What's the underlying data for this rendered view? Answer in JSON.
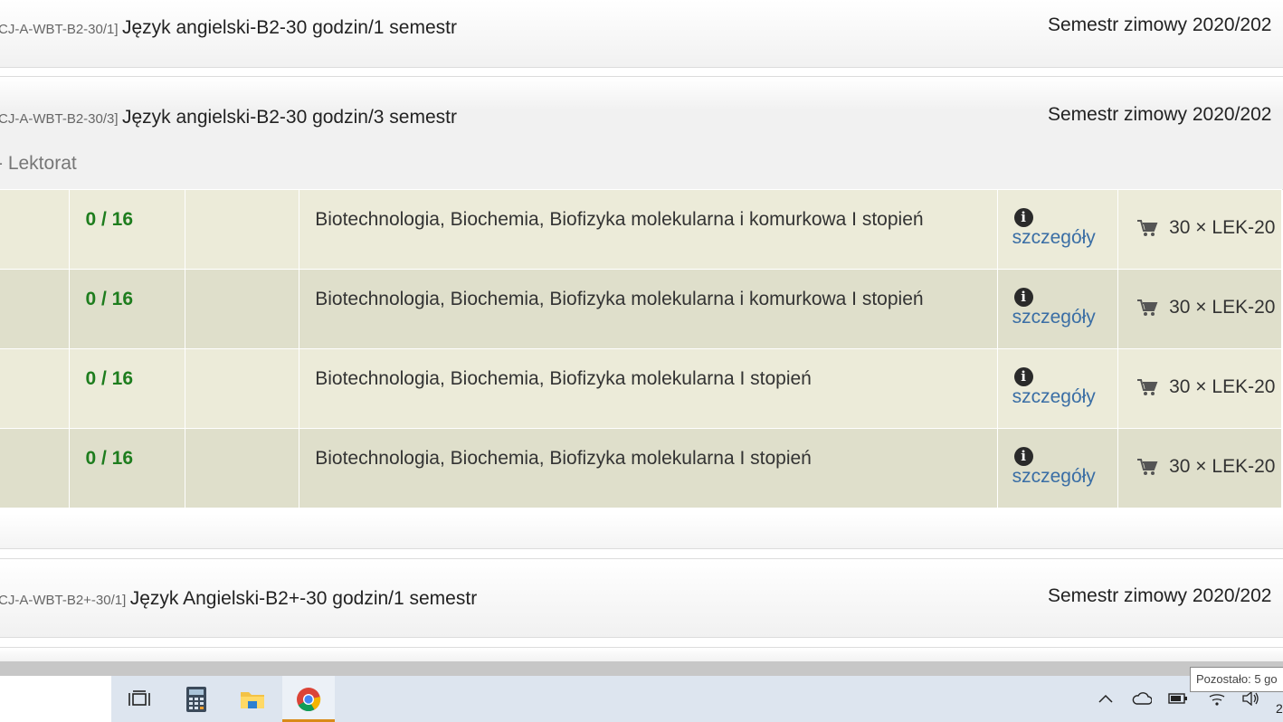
{
  "courses": [
    {
      "code": "CJ-A-WBT-B2-30/1]",
      "name": "Język angielski-B2-30 godzin/1 semestr",
      "semester": "Semestr zimowy 2020/202"
    },
    {
      "code": "CJ-A-WBT-B2-30/3]",
      "name": "Język angielski-B2-30 godzin/3 semestr",
      "semester": "Semestr zimowy 2020/202",
      "subtitle": "- Lektorat",
      "groups": [
        {
          "limit": "0 / 16",
          "program": "Biotechnologia, Biochemia, Biofizyka molekularna i komurkowa I stopień",
          "details": "szczegóły",
          "cart": "30 × LEK-20"
        },
        {
          "limit": "0 / 16",
          "program": "Biotechnologia, Biochemia, Biofizyka molekularna i komurkowa I stopień",
          "details": "szczegóły",
          "cart": "30 × LEK-20"
        },
        {
          "limit": "0 / 16",
          "program": "Biotechnologia, Biochemia, Biofizyka molekularna I stopień",
          "details": "szczegóły",
          "cart": "30 × LEK-20"
        },
        {
          "limit": "0 / 16",
          "program": "Biotechnologia, Biochemia, Biofizyka molekularna I stopień",
          "details": "szczegóły",
          "cart": "30 × LEK-20"
        }
      ]
    },
    {
      "code": "CJ-A-WBT-B2+-30/1]",
      "name": "Język Angielski-B2+-30 godzin/1 semestr",
      "semester": "Semestr zimowy 2020/202"
    }
  ],
  "taskbar": {
    "apps": [
      "task-view-icon",
      "calculator-icon",
      "file-explorer-icon",
      "chrome-icon"
    ],
    "active_app": "chrome-icon",
    "tray": [
      "chevron-up-icon",
      "onedrive-cloud-icon",
      "battery-icon",
      "wifi-icon",
      "volume-icon"
    ],
    "battery_tooltip": "Pozostało: 5 go",
    "clock_fragment": "2"
  },
  "colors": {
    "limit_green": "#1e7d1e",
    "link_blue": "#3a6ea5",
    "row_odd": "#ecebd9",
    "row_even": "#dfdfcb",
    "taskbar_bg": "#dde5ef",
    "active_indicator": "#d98a17"
  }
}
